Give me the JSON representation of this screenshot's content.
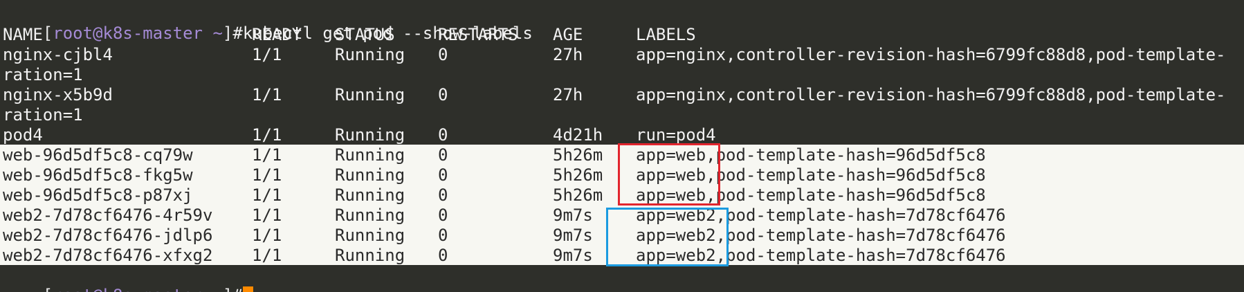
{
  "prompt": {
    "open_bracket": "[",
    "user_host": "root@k8s-master",
    "path": " ~",
    "close_bracket": "]",
    "symbol": "#"
  },
  "command": "kubectl get pod --show-labels",
  "headers": {
    "name": "NAME",
    "ready": "READY",
    "status": "STATUS",
    "restarts": "RESTARTS",
    "age": "AGE",
    "labels": "LABELS"
  },
  "rows": [
    {
      "name": "nginx-cjbl4",
      "ready": "1/1",
      "status": "Running",
      "restarts": "0",
      "age": "27h",
      "labels": "app=nginx,controller-revision-hash=6799fc88d8,pod-template-",
      "wrap": "ration=1"
    },
    {
      "name": "nginx-x5b9d",
      "ready": "1/1",
      "status": "Running",
      "restarts": "0",
      "age": "27h",
      "labels": "app=nginx,controller-revision-hash=6799fc88d8,pod-template-",
      "wrap": "ration=1"
    },
    {
      "name": "pod4",
      "ready": "1/1",
      "status": "Running",
      "restarts": "0",
      "age": "4d21h",
      "labels": "run=pod4"
    },
    {
      "name": "web-96d5df5c8-cq79w",
      "ready": "1/1",
      "status": "Running",
      "restarts": "0",
      "age": "5h26m",
      "labels": "app=web,pod-template-hash=96d5df5c8"
    },
    {
      "name": "web-96d5df5c8-fkg5w",
      "ready": "1/1",
      "status": "Running",
      "restarts": "0",
      "age": "5h26m",
      "labels": "app=web,pod-template-hash=96d5df5c8"
    },
    {
      "name": "web-96d5df5c8-p87xj",
      "ready": "1/1",
      "status": "Running",
      "restarts": "0",
      "age": "5h26m",
      "labels": "app=web,pod-template-hash=96d5df5c8"
    },
    {
      "name": "web2-7d78cf6476-4r59v",
      "ready": "1/1",
      "status": "Running",
      "restarts": "0",
      "age": "9m7s",
      "labels": "app=web2,pod-template-hash=7d78cf6476"
    },
    {
      "name": "web2-7d78cf6476-jdlp6",
      "ready": "1/1",
      "status": "Running",
      "restarts": "0",
      "age": "9m7s",
      "labels": "app=web2,pod-template-hash=7d78cf6476"
    },
    {
      "name": "web2-7d78cf6476-xfxg2",
      "ready": "1/1",
      "status": "Running",
      "restarts": "0",
      "age": "9m7s",
      "labels": "app=web2,pod-template-hash=7d78cf6476"
    }
  ],
  "colors": {
    "background": "#2e2f2a",
    "highlight_band": "#f7f7f2",
    "prompt_host": "#a58bd6",
    "cursor": "#ff8a00",
    "box_red": "#e2252e",
    "box_blue": "#1b9be0"
  }
}
